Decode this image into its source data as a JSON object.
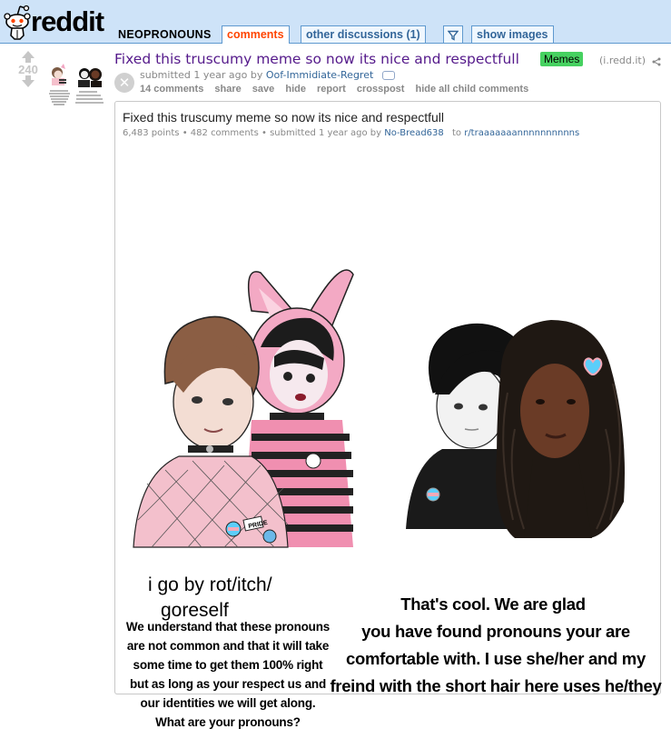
{
  "header": {
    "wordmark": "reddit",
    "subreddit": "NEOPRONOUNS",
    "tabs": {
      "comments": "comments",
      "other": "other discussions (1)",
      "filter_icon": "filter-icon",
      "images": "show images"
    }
  },
  "post": {
    "score": "240",
    "title": "Fixed this truscumy meme so now its nice and respectfull",
    "flair": "Memes",
    "domain": "(i.redd.it)",
    "tagline": {
      "prefix": "submitted",
      "time": "1 year ago",
      "by": "by",
      "author": "Oof-Immidiate-Regret"
    },
    "buttons": [
      "14 comments",
      "share",
      "save",
      "hide",
      "report",
      "crosspost",
      "hide all child comments"
    ]
  },
  "embed": {
    "title": "Fixed this truscumy meme so now its nice and respectfull",
    "points": "6,483 points",
    "comments": "482 comments",
    "submitted": "submitted 1 year ago by",
    "author": "No-Bread638",
    "to": "to",
    "subreddit": "r/traaaaaaannnnnnnnnns",
    "meme": {
      "left_caption_1": "i go by rot/itch/",
      "left_caption_2": "goreself",
      "left_response": [
        "We understand that these pronouns",
        "are not common and that it will take",
        "some time to get them 100% right",
        "but as long as your respect us and",
        "our identities we will get along.",
        "What are your pronouns?"
      ],
      "right_response": [
        "That's cool. We are glad",
        "you have found pronouns your are",
        "comfortable with. I use she/her and my",
        "freind with the short hair here uses he/they"
      ],
      "badge": "PRIDE"
    }
  },
  "colors": {
    "header_bg": "#cee3f8",
    "tab_text": "#336699",
    "selected_tab": "#ff4500",
    "visited_title": "#551a8b",
    "flair_bg": "#46d160"
  }
}
